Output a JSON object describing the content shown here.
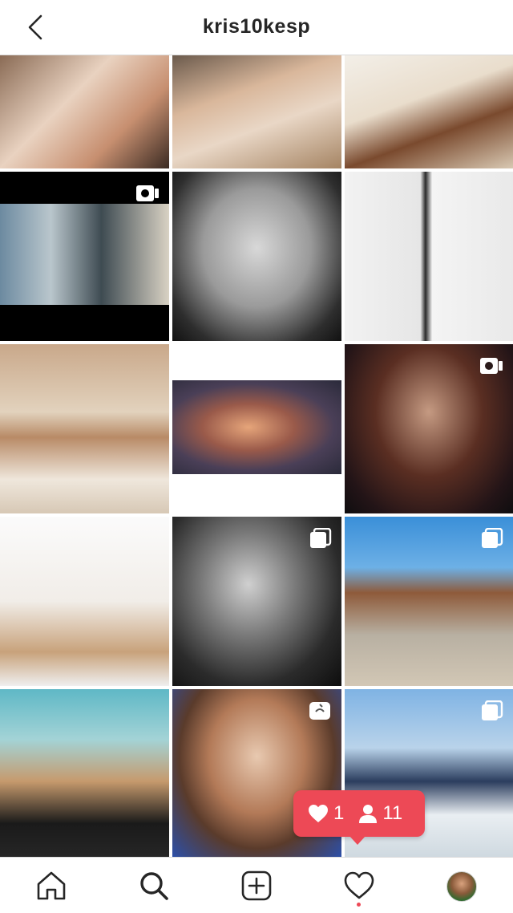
{
  "header": {
    "title": "kris10kesp",
    "back_icon": "chevron-left-icon"
  },
  "grid": {
    "tiles": [
      {
        "name": "post-1",
        "badge": null
      },
      {
        "name": "post-2",
        "badge": null
      },
      {
        "name": "post-3",
        "badge": null
      },
      {
        "name": "post-4",
        "badge": "igtv-video-icon"
      },
      {
        "name": "post-5",
        "badge": null
      },
      {
        "name": "post-6",
        "badge": null
      },
      {
        "name": "post-7",
        "badge": null
      },
      {
        "name": "post-8",
        "badge": null
      },
      {
        "name": "post-9",
        "badge": "igtv-video-icon"
      },
      {
        "name": "post-10",
        "badge": null
      },
      {
        "name": "post-11",
        "badge": "carousel-icon"
      },
      {
        "name": "post-12",
        "badge": "carousel-icon"
      },
      {
        "name": "post-13",
        "badge": null
      },
      {
        "name": "post-14",
        "badge": "igtv-video-icon"
      },
      {
        "name": "post-15",
        "badge": "carousel-icon"
      }
    ]
  },
  "activity_popup": {
    "likes_icon": "heart-icon",
    "likes_count": "1",
    "followers_icon": "person-icon",
    "followers_count": "11",
    "color": "#ed4956"
  },
  "tabbar": {
    "items": [
      {
        "name": "tab-home",
        "icon": "home-icon"
      },
      {
        "name": "tab-search",
        "icon": "search-icon",
        "active": true
      },
      {
        "name": "tab-new-post",
        "icon": "plus-square-icon"
      },
      {
        "name": "tab-activity",
        "icon": "heart-icon",
        "notification_dot": true
      },
      {
        "name": "tab-profile",
        "icon": "avatar"
      }
    ]
  },
  "colors": {
    "divider": "#dbdbdb",
    "text": "#262626",
    "notification": "#ed4956"
  }
}
